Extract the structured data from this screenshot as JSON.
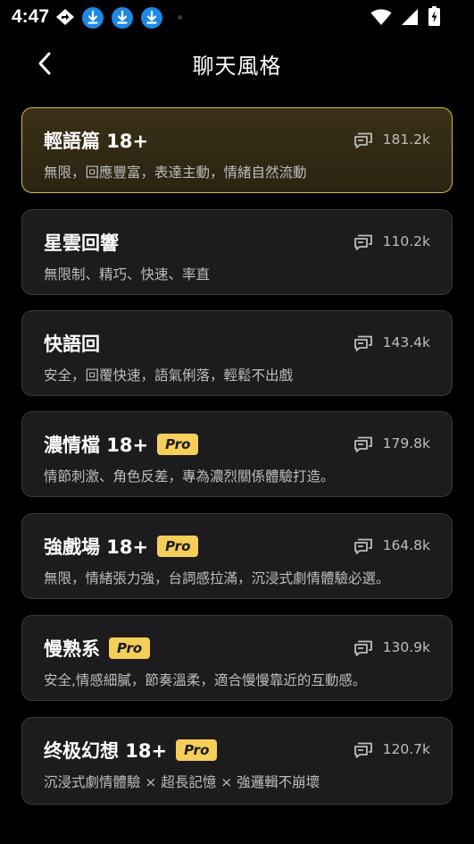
{
  "status_bar": {
    "time": "4:47",
    "left_icons": [
      "navigation-diamond-icon",
      "download-icon",
      "download-icon",
      "download-icon",
      "notification-dot-icon"
    ],
    "right_icons": [
      "wifi-icon",
      "signal-icon",
      "battery-charging-icon"
    ]
  },
  "header": {
    "title": "聊天風格",
    "back_icon": "chevron-left-icon"
  },
  "colors": {
    "background": "#000000",
    "card_bg": "#1c1c1e",
    "card_border": "#3a3a3c",
    "selected_border": "#d8b648",
    "pro_badge": "#f6cf5a",
    "download_badge": "#1e88e5"
  },
  "styles": [
    {
      "name": "輕語篇 18+",
      "pro": false,
      "count": "181.2k",
      "desc": "無限，回應豐富，表達主動，情緒自然流動",
      "selected": true
    },
    {
      "name": "星雲回響",
      "pro": false,
      "count": "110.2k",
      "desc": "無限制、精巧、快速、率直",
      "selected": false
    },
    {
      "name": "快語回",
      "pro": false,
      "count": "143.4k",
      "desc": "安全，回覆快速，語氣俐落，輕鬆不出戲",
      "selected": false
    },
    {
      "name": "濃情檔 18+",
      "pro": true,
      "count": "179.8k",
      "desc": "情節刺激、角色反差，專為濃烈關係體驗打造。",
      "selected": false
    },
    {
      "name": "強戲場 18+",
      "pro": true,
      "count": "164.8k",
      "desc": "無限，情緒張力強，台詞感拉滿，沉浸式劇情體驗必選。",
      "selected": false
    },
    {
      "name": "慢熟系",
      "pro": true,
      "count": "130.9k",
      "desc": "安全,情感細膩，節奏溫柔，適合慢慢靠近的互動感。",
      "selected": false
    },
    {
      "name": "终极幻想 18+",
      "pro": true,
      "count": "120.7k",
      "desc": "沉浸式劇情體驗 × 超長記憶 × 強邏輯不崩壞",
      "selected": false
    }
  ],
  "pro_label": "Pro"
}
